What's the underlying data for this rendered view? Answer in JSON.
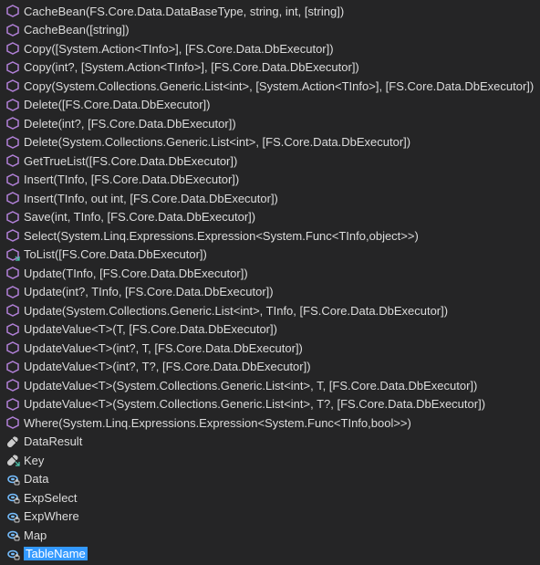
{
  "items": [
    {
      "icon": "method",
      "label": "CacheBean(FS.Core.Data.DataBaseType, string, int, [string])"
    },
    {
      "icon": "method",
      "label": "CacheBean([string])"
    },
    {
      "icon": "method",
      "label": "Copy([System.Action<TInfo>], [FS.Core.Data.DbExecutor])"
    },
    {
      "icon": "method",
      "label": "Copy(int?, [System.Action<TInfo>], [FS.Core.Data.DbExecutor])"
    },
    {
      "icon": "method",
      "label": "Copy(System.Collections.Generic.List<int>, [System.Action<TInfo>], [FS.Core.Data.DbExecutor])"
    },
    {
      "icon": "method",
      "label": "Delete([FS.Core.Data.DbExecutor])"
    },
    {
      "icon": "method",
      "label": "Delete(int?, [FS.Core.Data.DbExecutor])"
    },
    {
      "icon": "method",
      "label": "Delete(System.Collections.Generic.List<int>, [FS.Core.Data.DbExecutor])"
    },
    {
      "icon": "method",
      "label": "GetTrueList([FS.Core.Data.DbExecutor])"
    },
    {
      "icon": "method",
      "label": "Insert(TInfo, [FS.Core.Data.DbExecutor])"
    },
    {
      "icon": "method",
      "label": "Insert(TInfo, out int, [FS.Core.Data.DbExecutor])"
    },
    {
      "icon": "method",
      "label": "Save(int, TInfo, [FS.Core.Data.DbExecutor])"
    },
    {
      "icon": "method",
      "label": "Select(System.Linq.Expressions.Expression<System.Func<TInfo,object>>)"
    },
    {
      "icon": "method-ext",
      "label": "ToList([FS.Core.Data.DbExecutor])"
    },
    {
      "icon": "method",
      "label": "Update(TInfo, [FS.Core.Data.DbExecutor])"
    },
    {
      "icon": "method",
      "label": "Update(int?, TInfo, [FS.Core.Data.DbExecutor])"
    },
    {
      "icon": "method",
      "label": "Update(System.Collections.Generic.List<int>, TInfo, [FS.Core.Data.DbExecutor])"
    },
    {
      "icon": "method",
      "label": "UpdateValue<T>(T, [FS.Core.Data.DbExecutor])"
    },
    {
      "icon": "method",
      "label": "UpdateValue<T>(int?, T, [FS.Core.Data.DbExecutor])"
    },
    {
      "icon": "method",
      "label": "UpdateValue<T>(int?, T?, [FS.Core.Data.DbExecutor])"
    },
    {
      "icon": "method",
      "label": "UpdateValue<T>(System.Collections.Generic.List<int>, T, [FS.Core.Data.DbExecutor])"
    },
    {
      "icon": "method",
      "label": "UpdateValue<T>(System.Collections.Generic.List<int>, T?, [FS.Core.Data.DbExecutor])"
    },
    {
      "icon": "method",
      "label": "Where(System.Linq.Expressions.Expression<System.Func<TInfo,bool>>)"
    },
    {
      "icon": "property",
      "label": "DataResult"
    },
    {
      "icon": "property-ext",
      "label": "Key"
    },
    {
      "icon": "field",
      "label": "Data"
    },
    {
      "icon": "field",
      "label": "ExpSelect"
    },
    {
      "icon": "field",
      "label": "ExpWhere"
    },
    {
      "icon": "field",
      "label": "Map"
    },
    {
      "icon": "field",
      "label": "TableName",
      "selected": true
    }
  ]
}
